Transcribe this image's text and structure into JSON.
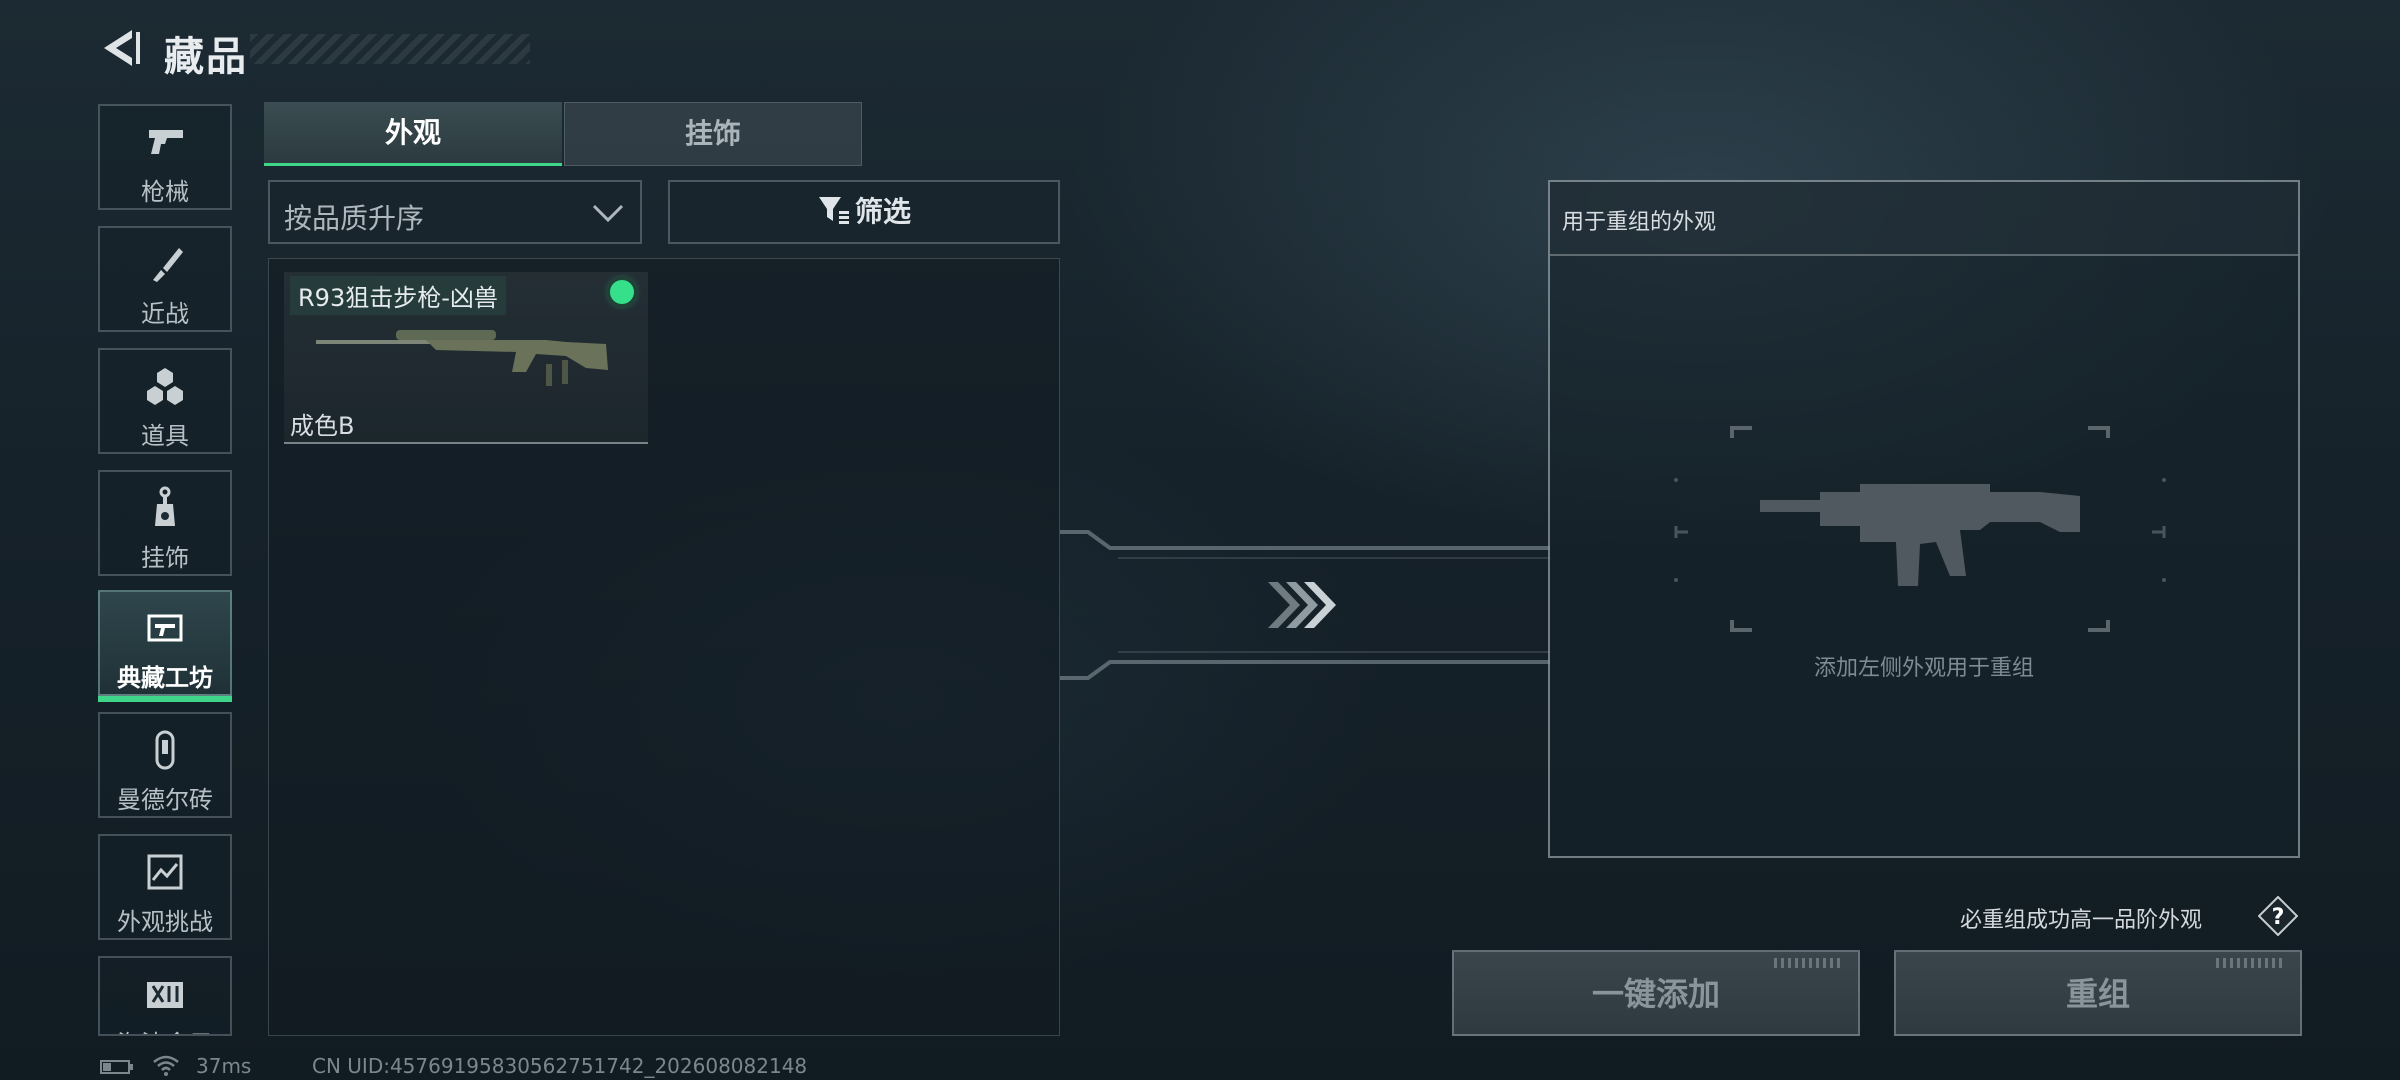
{
  "header": {
    "title": "藏品",
    "back_icon": "back-arrow-icon"
  },
  "sidebar": {
    "items": [
      {
        "label": "枪械",
        "icon": "pistol-icon",
        "active": false
      },
      {
        "label": "近战",
        "icon": "knife-icon",
        "active": false
      },
      {
        "label": "道具",
        "icon": "grenades-icon",
        "active": false
      },
      {
        "label": "挂饰",
        "icon": "charm-icon",
        "active": false
      },
      {
        "label": "典藏工坊",
        "icon": "gun-frame-icon",
        "active": true
      },
      {
        "label": "曼德尔砖",
        "icon": "mandel-brick-icon",
        "active": false
      },
      {
        "label": "外观挑战",
        "icon": "challenge-icon",
        "active": false
      },
      {
        "label": "淘汰盒子",
        "icon": "box-icon",
        "active": false
      }
    ]
  },
  "tabs": [
    {
      "label": "外观",
      "active": true
    },
    {
      "label": "挂饰",
      "active": false
    }
  ],
  "sort": {
    "label": "按品质升序",
    "icon": "chevron-down-icon"
  },
  "filter": {
    "label": "筛选",
    "icon": "filter-icon"
  },
  "items": [
    {
      "name": "R93狙击步枪-凶兽",
      "grade": "成色B",
      "selected": true,
      "icon": "sniper-rifle-icon"
    }
  ],
  "recombine_panel": {
    "title": "用于重组的外观",
    "hint": "添加左侧外观用于重组",
    "placeholder_icon": "assault-rifle-icon"
  },
  "rule": {
    "text": "必重组成功高一品阶外观",
    "help_icon": "question-icon"
  },
  "buttons": {
    "add_all": "一键添加",
    "recombine": "重组"
  },
  "status": {
    "ping": "37ms",
    "uid": "CN UID:457691958305627517​42_202608082148"
  },
  "colors": {
    "accent": "#3fd68a",
    "background": "#16222a",
    "border": "#a0afb9"
  }
}
